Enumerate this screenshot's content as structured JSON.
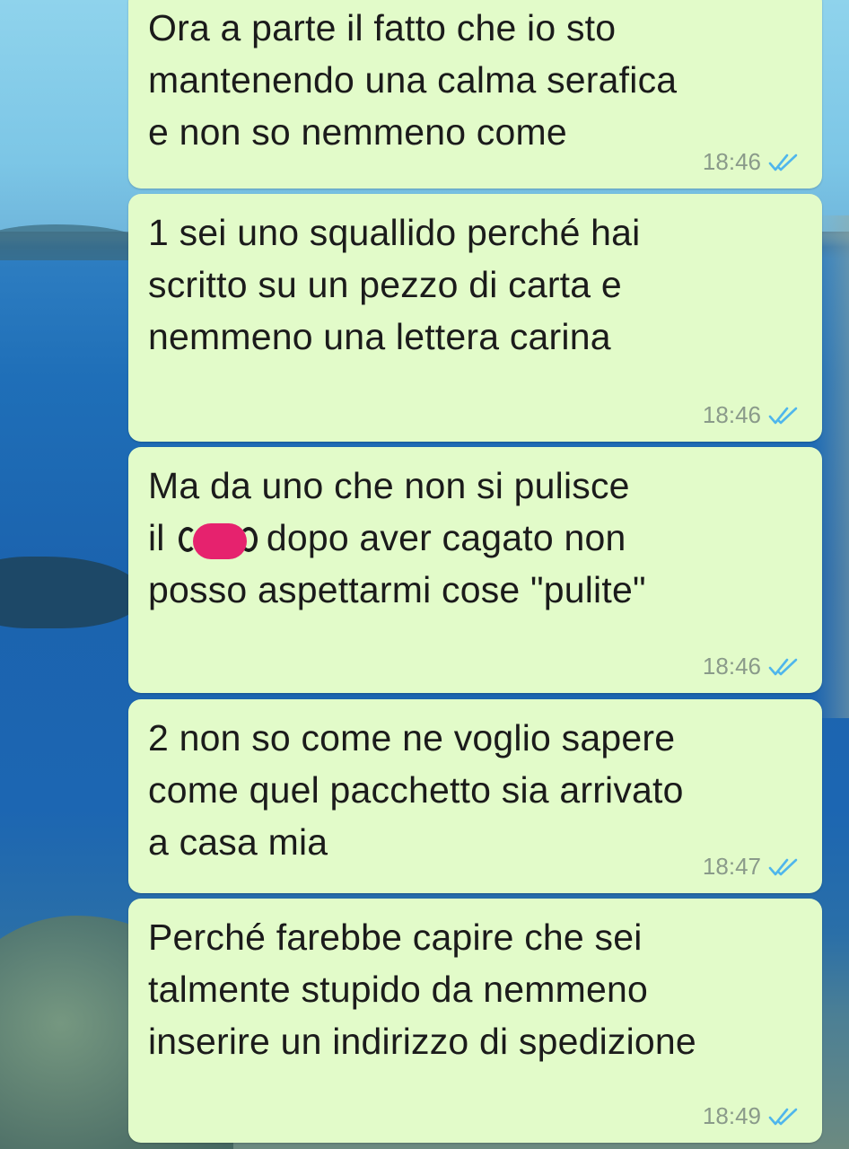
{
  "wallpaper": {
    "description_icon": "sea-landscape-wallpaper"
  },
  "colors": {
    "bubble_background": "#e2fbc9",
    "text": "#1b1b1b",
    "timestamp": "#8a9a8a",
    "read_ticks": "#4fb6ec",
    "censor": "#e6226e"
  },
  "messages": [
    {
      "lines": [
        "Ora a parte il fatto che io sto",
        "mantenendo una calma serafica",
        "e non so nemmeno come"
      ],
      "time": "18:46",
      "status_icon": "double-check-read-icon"
    },
    {
      "lines": [
        "1 sei uno squallido perché hai",
        "scritto su un pezzo di carta e",
        "nemmeno una lettera carina"
      ],
      "time": "18:46",
      "status_icon": "double-check-read-icon"
    },
    {
      "line1": "Ma da uno che non si pulisce",
      "line2_prefix": "il",
      "line2_suffix": "dopo aver cagato non",
      "line3": "posso aspettarmi cose \"pulite\"",
      "censor_icon": "pink-censor-mark",
      "time": "18:46",
      "status_icon": "double-check-read-icon"
    },
    {
      "lines": [
        "2 non so come ne voglio sapere",
        "come quel pacchetto sia arrivato",
        "a casa mia"
      ],
      "time": "18:47",
      "status_icon": "double-check-read-icon"
    },
    {
      "lines": [
        "Perché farebbe capire che sei",
        "talmente stupido da nemmeno",
        "inserire un indirizzo di spedizione"
      ],
      "time": "18:49",
      "status_icon": "double-check-read-icon"
    }
  ]
}
